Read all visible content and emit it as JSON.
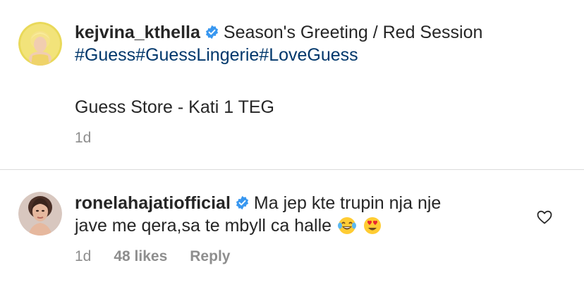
{
  "caption": {
    "username": "kejvina_kthella",
    "text": "Season's Greeting / Red Session",
    "hashtags": [
      "#Guess",
      "#GuessLingerie",
      "#LoveGuess"
    ],
    "store_line": "Guess Store - Kati 1 TEG",
    "time": "1d",
    "verified_icon": "verified-badge-icon"
  },
  "comment": {
    "username": "ronelahajatiofficial",
    "text_line1": "Ma jep kte trupin nja nje",
    "text_line2": "jave me qera,sa te mbyll ca halle",
    "emojis": [
      "face-with-tears-of-joy-icon",
      "heart-eyes-icon"
    ],
    "time": "1d",
    "likes": "48 likes",
    "reply_label": "Reply",
    "verified_icon": "verified-badge-icon"
  },
  "colors": {
    "text": "#262626",
    "hashtag": "#00376b",
    "secondary": "#8e8e8e",
    "verified": "#3897f0",
    "divider": "#dbdbdb"
  }
}
